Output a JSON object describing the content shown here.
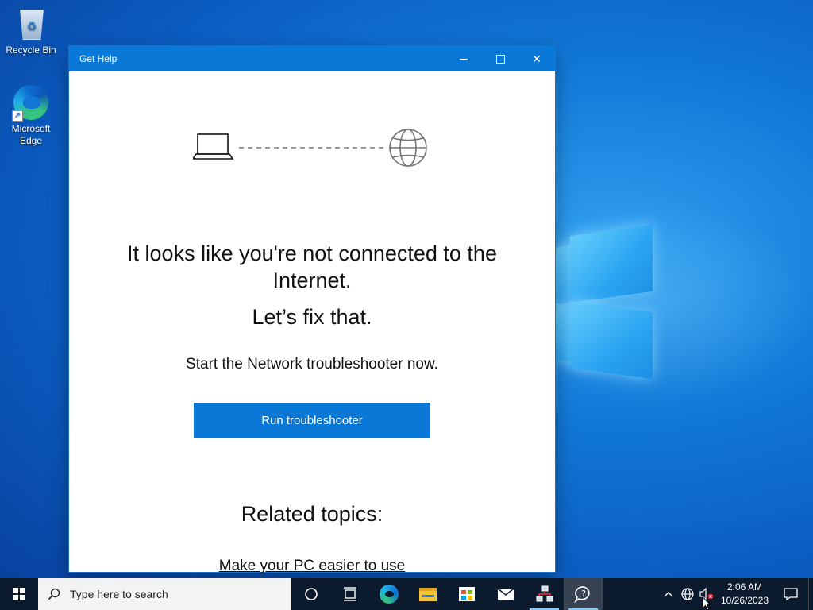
{
  "desktop": {
    "icons": [
      {
        "label": "Recycle Bin"
      },
      {
        "label": "Microsoft Edge"
      }
    ]
  },
  "window": {
    "title": "Get Help",
    "buttons": {
      "minimize": "minimize",
      "maximize": "maximize",
      "close": "✕"
    },
    "heading": "It looks like you're not connected to the Internet.",
    "fix": "Let’s fix that.",
    "subtext": "Start the Network troubleshooter now.",
    "run_button": "Run troubleshooter",
    "related_title": "Related topics:",
    "related_link": "Make your PC easier to use",
    "illustration": {
      "left": "laptop-icon",
      "right": "globe-icon"
    }
  },
  "taskbar": {
    "search_placeholder": "Type here to search",
    "pinned": [
      "cortana-icon",
      "task-view-icon",
      "edge-icon",
      "file-explorer-icon",
      "store-icon",
      "mail-icon",
      "network-app-icon",
      "get-help-icon"
    ],
    "clock": {
      "time": "2:06 AM",
      "date": "10/26/2023"
    }
  },
  "colors": {
    "accent": "#0a78d7",
    "taskbar": "#0c1a2e"
  }
}
